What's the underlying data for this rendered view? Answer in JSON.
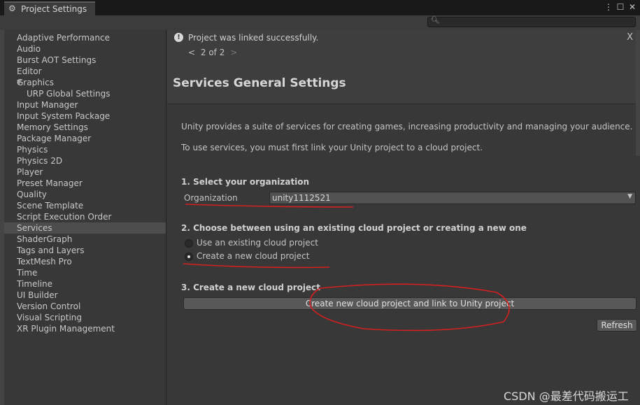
{
  "window": {
    "tab_title": "Project Settings",
    "tab_icon": "gear-icon",
    "menu_icon": "kebab-menu-icon",
    "maximize_icon": "maximize-icon",
    "close_icon": "close-icon"
  },
  "search": {
    "placeholder": "",
    "value": ""
  },
  "sidebar": {
    "items": [
      {
        "label": "Adaptive Performance"
      },
      {
        "label": "Audio"
      },
      {
        "label": "Burst AOT Settings"
      },
      {
        "label": "Editor"
      },
      {
        "label": "Graphics",
        "expanded": true
      },
      {
        "label": "URP Global Settings",
        "child": true
      },
      {
        "label": "Input Manager"
      },
      {
        "label": "Input System Package"
      },
      {
        "label": "Memory Settings"
      },
      {
        "label": "Package Manager"
      },
      {
        "label": "Physics"
      },
      {
        "label": "Physics 2D"
      },
      {
        "label": "Player"
      },
      {
        "label": "Preset Manager"
      },
      {
        "label": "Quality"
      },
      {
        "label": "Scene Template"
      },
      {
        "label": "Script Execution Order"
      },
      {
        "label": "Services",
        "selected": true
      },
      {
        "label": "ShaderGraph"
      },
      {
        "label": "Tags and Layers"
      },
      {
        "label": "TextMesh Pro"
      },
      {
        "label": "Time"
      },
      {
        "label": "Timeline"
      },
      {
        "label": "UI Builder"
      },
      {
        "label": "Version Control"
      },
      {
        "label": "Visual Scripting"
      },
      {
        "label": "XR Plugin Management"
      }
    ]
  },
  "notification": {
    "icon": "info-icon",
    "message": "Project was linked successfully.",
    "prev": "<",
    "page": "2 of 2",
    "next": ">",
    "close": "X"
  },
  "header": {
    "title": "Services General Settings"
  },
  "content": {
    "intro": "Unity provides a suite of services for creating games, increasing productivity and managing your audience.",
    "link_note": "To use services, you must first link your Unity project to a cloud project.",
    "step1_title": "1. Select your organization",
    "org_label": "Organization",
    "org_value": "unity1112521",
    "step2_title": "2. Choose between using an existing cloud project or creating a new one",
    "radio_existing": "Use an existing cloud project",
    "radio_new": "Create a new cloud project",
    "radio_selected": "new",
    "step3_title": "3. Create a new cloud project",
    "create_button": "Create new cloud project and link to Unity project",
    "refresh_button": "Refresh"
  },
  "annotation_color": "#d42020",
  "watermark": "CSDN @最差代码搬运工"
}
